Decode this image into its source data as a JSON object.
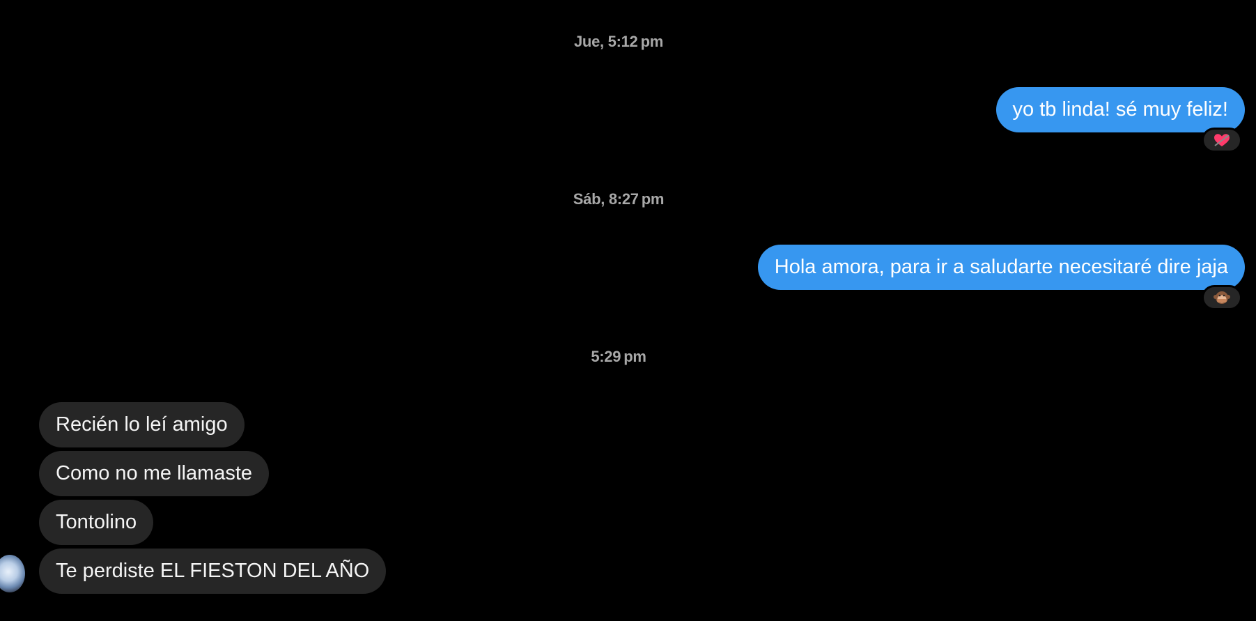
{
  "conversation": [
    {
      "type": "timestamp",
      "text": "Jue, 5:12 pm"
    },
    {
      "type": "message",
      "direction": "outgoing",
      "text": "yo tb linda! sé muy feliz!",
      "reaction": "heart-with-arrow-icon"
    },
    {
      "type": "timestamp",
      "text": "Sáb, 8:27 pm"
    },
    {
      "type": "message",
      "direction": "outgoing",
      "text": "Hola amora, para ir a saludarte necesitaré dire jaja",
      "reaction": "speak-no-evil-monkey-icon"
    },
    {
      "type": "timestamp",
      "text": "5:29 pm"
    },
    {
      "type": "message",
      "direction": "incoming",
      "text": "Recién lo leí amigo"
    },
    {
      "type": "message",
      "direction": "incoming",
      "text": "Como no me llamaste"
    },
    {
      "type": "message",
      "direction": "incoming",
      "text": "Tontolino"
    },
    {
      "type": "message",
      "direction": "incoming",
      "text": "Te perdiste EL FIESTON DEL AÑO"
    }
  ],
  "colors": {
    "background": "#000000",
    "outgoing_bubble": "#3797f0",
    "incoming_bubble": "#262626",
    "timestamp_text": "#a8a8a8"
  }
}
